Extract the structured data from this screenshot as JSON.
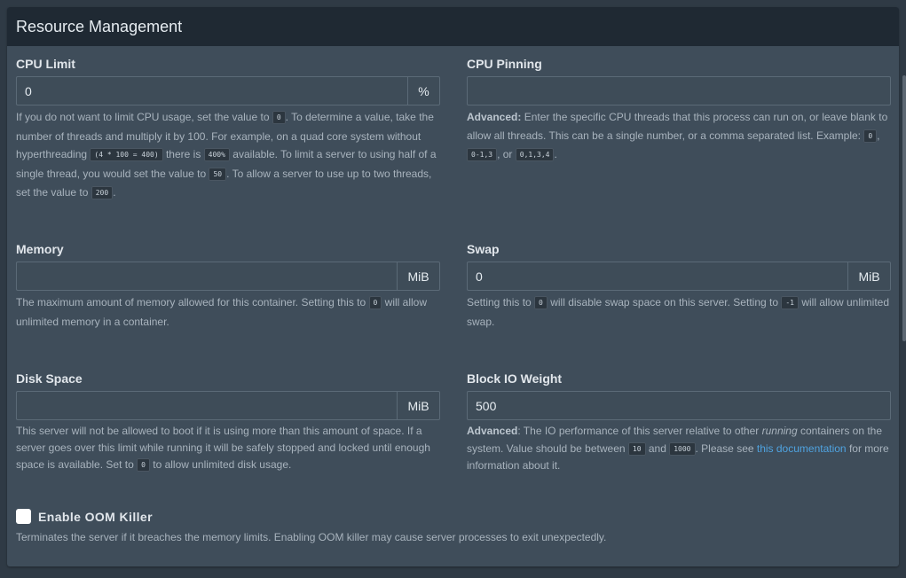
{
  "panel": {
    "title": "Resource Management"
  },
  "cpu_limit": {
    "label": "CPU Limit",
    "value": "0",
    "unit": "%",
    "help": {
      "t1": "If you do not want to limit CPU usage, set the value to ",
      "c1": "0",
      "t2": ". To determine a value, take the number of threads and multiply it by 100. For example, on a quad core system without hyperthreading ",
      "c2": "(4 * 100 = 400)",
      "t3": " there is ",
      "c3": "400%",
      "t4": " available. To limit a server to using half of a single thread, you would set the value to ",
      "c4": "50",
      "t5": ". To allow a server to use up to two threads, set the value to ",
      "c5": "200",
      "t6": "."
    }
  },
  "cpu_pinning": {
    "label": "CPU Pinning",
    "value": "",
    "help": {
      "bold": "Advanced:",
      "t1": " Enter the specific CPU threads that this process can run on, or leave blank to allow all threads. This can be a single number, or a comma separated list. Example: ",
      "c1": "0",
      "t2": ", ",
      "c2": "0-1,3",
      "t3": ", or ",
      "c3": "0,1,3,4",
      "t4": "."
    }
  },
  "memory": {
    "label": "Memory",
    "value": "",
    "unit": "MiB",
    "help": {
      "t1": "The maximum amount of memory allowed for this container. Setting this to ",
      "c1": "0",
      "t2": " will allow unlimited memory in a container."
    }
  },
  "swap": {
    "label": "Swap",
    "value": "0",
    "unit": "MiB",
    "help": {
      "t1": "Setting this to ",
      "c1": "0",
      "t2": " will disable swap space on this server. Setting to ",
      "c2": "-1",
      "t3": " will allow unlimited swap."
    }
  },
  "disk": {
    "label": "Disk Space",
    "value": "",
    "unit": "MiB",
    "help": {
      "t1": "This server will not be allowed to boot if it is using more than this amount of space. If a server goes over this limit while running it will be safely stopped and locked until enough space is available. Set to ",
      "c1": "0",
      "t2": " to allow unlimited disk usage."
    }
  },
  "block_io": {
    "label": "Block IO Weight",
    "value": "500",
    "help": {
      "bold": "Advanced",
      "t1": ": The IO performance of this server relative to other ",
      "italic": "running",
      "t2": " containers on the system. Value should be between ",
      "c1": "10",
      "t3": " and ",
      "c2": "1000",
      "t4": ". Please see ",
      "link": "this documentation",
      "t5": " for more information about it."
    }
  },
  "oom": {
    "label": "Enable OOM Killer",
    "checked": false,
    "help": "Terminates the server if it breaches the memory limits. Enabling OOM killer may cause server processes to exit unexpectedly."
  },
  "colors": {
    "panel_bg": "#3f4d5a",
    "header_bg": "#1f2933",
    "link": "#4fa3e0"
  }
}
